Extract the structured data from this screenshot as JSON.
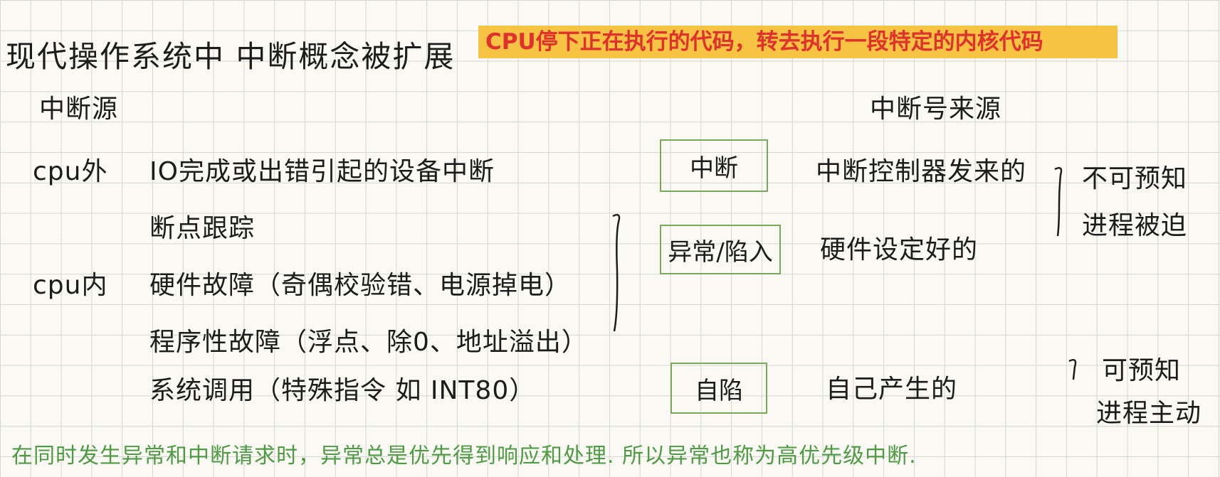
{
  "title": "现代操作系统中 中断概念被扩展",
  "highlight": "CPU停下正在执行的代码，转去执行一段特定的内核代码",
  "left_heading": "中断源",
  "right_heading": "中断号来源",
  "cpu_outside": {
    "label": "cpu外",
    "items": [
      "IO完成或出错引起的设备中断"
    ]
  },
  "cpu_inside": {
    "label": "cpu内",
    "items": [
      "断点跟踪",
      "硬件故障（奇偶校验错、电源掉电）",
      "程序性故障（浮点、除0、地址溢出）",
      "系统调用（特殊指令 如 INT80）"
    ]
  },
  "types": [
    {
      "name": "中断",
      "source": "中断控制器发来的"
    },
    {
      "name": "异常/陷入",
      "source": "硬件设定好的"
    },
    {
      "name": "自陷",
      "source": "自己产生的"
    }
  ],
  "unpredictable": [
    "不可预知",
    "进程被迫"
  ],
  "predictable": [
    "可预知",
    "进程主动"
  ],
  "footer": "在同时发生异常和中断请求时，异常总是优先得到响应和处理. 所以异常也称为高优先级中断.",
  "colors": {
    "highlight_bg": "#f6c342",
    "highlight_text": "#e0312c",
    "box_border": "#79a85a",
    "footer_text": "#4f9a45"
  }
}
